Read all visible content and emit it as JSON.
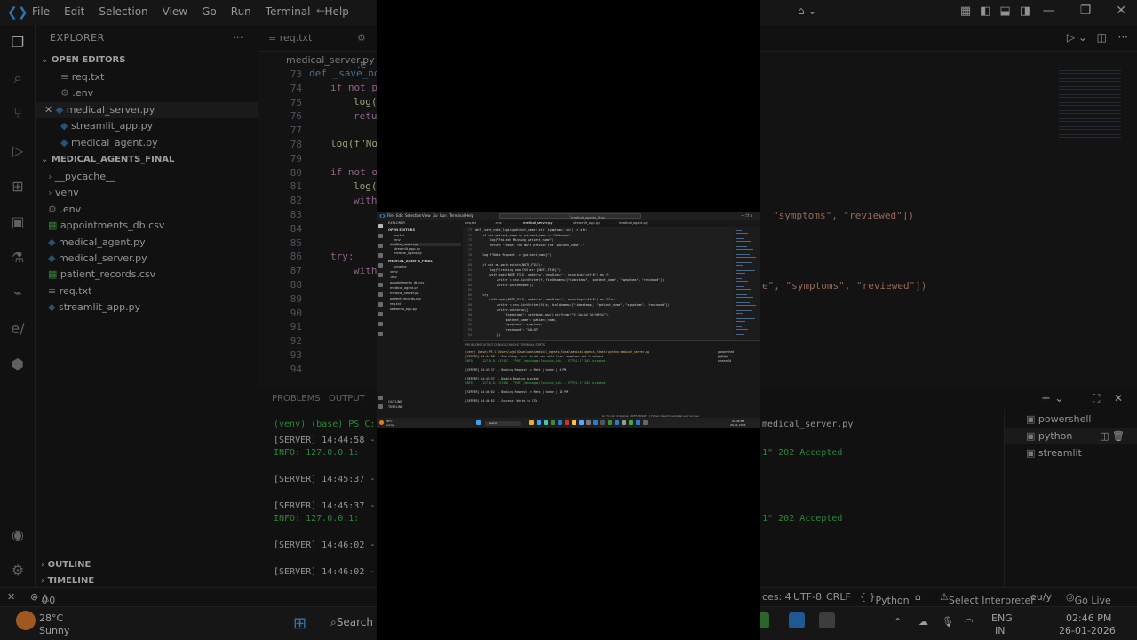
{
  "app": {
    "menu": [
      "File",
      "Edit",
      "Selection",
      "View",
      "Go",
      "Run",
      "Terminal",
      "Help"
    ],
    "window_controls": [
      "—",
      "❐",
      "✕"
    ]
  },
  "explorer": {
    "title": "EXPLORER",
    "open_editors_label": "OPEN EDITORS",
    "open_editors": [
      "req.txt",
      ".env",
      "medical_server.py",
      "streamlit_app.py",
      "medical_agent.py"
    ],
    "project_label": "MEDICAL_AGENTS_FINAL",
    "files": [
      "__pycache__",
      "venv",
      ".env",
      "appointments_db.csv",
      "medical_agent.py",
      "medical_server.py",
      "patient_records.csv",
      "req.txt",
      "streamlit_app.py"
    ],
    "outline_label": "OUTLINE",
    "timeline_label": "TIMELINE"
  },
  "editor": {
    "tabs": [
      "req.txt",
      ".e"
    ],
    "breadcrumb": "medical_server.py",
    "line_numbers": [
      "73",
      "74",
      "75",
      "76",
      "77",
      "78",
      "79",
      "80",
      "81",
      "82",
      "83",
      "84",
      "85",
      "86",
      "87",
      "88",
      "89",
      "90",
      "91",
      "92",
      "93",
      "94"
    ],
    "visible_fragments": {
      "l73": "def _save_no",
      "l74": "if not p",
      "l75": "log(",
      "l76": "retu",
      "l78": "log(f\"No",
      "l80": "if not o",
      "l81": "log(",
      "l82": "with",
      "l86": "try:",
      "l87": "with"
    },
    "right_fragment_1": "\"symptoms\", \"reviewed\"])",
    "right_fragment_2": "e\", \"symptoms\", \"reviewed\"])"
  },
  "panel": {
    "tabs": [
      "PROBLEMS",
      "OUTPUT"
    ],
    "terminal_lines": [
      "(venv) (base) PS C:",
      "[SERVER] 14:44:58 -",
      "INFO:     127.0.0.1:",
      "[SERVER] 14:45:37 -",
      "[SERVER] 14:45:37 -",
      "INFO:     127.0.0.1:",
      "[SERVER] 14:46:02 -",
      "[SERVER] 14:46:02 -"
    ],
    "terminal_right_1": "medical_server.py",
    "terminal_right_2": "TP/1.1\" 202 Accepted",
    "terminal_right_3": "TP/1.1\" 202 Accepted",
    "terminal_instances": [
      "powershell",
      "python",
      "streamlit"
    ]
  },
  "statusbar": {
    "errors": "0",
    "warnings": "0",
    "spaces": "ces: 4",
    "encoding": "UTF-8",
    "eol": "CRLF",
    "language": "Python",
    "interpreter": "Select Interpreter",
    "eslint": "eu/y",
    "golive": "Go Live"
  },
  "taskbar": {
    "weather_temp": "28°C",
    "weather_desc": "Sunny",
    "search": "Search",
    "lang": "ENG",
    "region": "IN",
    "time": "02:46 PM",
    "date": "26-01-2026"
  },
  "mini": {
    "search_text": "medical_agents_final",
    "tabs": [
      "req.txt",
      ".env",
      "medical_server.py",
      "streamlit_app.py",
      "medical_agent.py"
    ],
    "code_lines": [
      {
        "n": "73",
        "t": "def _save_note_logic(patient_name: str, symptoms: str) -> str:"
      },
      {
        "n": "74",
        "t": "    if not patient_name or patient_name == \"Unknown\":"
      },
      {
        "n": "75",
        "t": "        log(\"Failed: Missing patient_name\")"
      },
      {
        "n": "76",
        "t": "        return \"ERROR: You must provide the 'patient_name'.\""
      },
      {
        "n": "77",
        "t": ""
      },
      {
        "n": "78",
        "t": "    log(f\"Note Request -> {patient_name}\")"
      },
      {
        "n": "79",
        "t": ""
      },
      {
        "n": "80",
        "t": "    if not os.path.exists(NOTE_FILE):"
      },
      {
        "n": "81",
        "t": "        log(\"Creating new CSV at: {NOTE_FILE}\")"
      },
      {
        "n": "82",
        "t": "        with open(NOTE_FILE, mode='w', newline='', encoding='utf-8') as f:"
      },
      {
        "n": "83",
        "t": "            writer = csv.DictWriter(f, fieldnames=[\"timestamp\", \"patient_name\", \"symptoms\", \"reviewed\"])"
      },
      {
        "n": "84",
        "t": "            writer.writeheader()"
      },
      {
        "n": "85",
        "t": ""
      },
      {
        "n": "86",
        "t": "    try:"
      },
      {
        "n": "87",
        "t": "        with open(NOTE_FILE, mode='a', newline='', encoding='utf-8') as file:"
      },
      {
        "n": "88",
        "t": "            writer = csv.DictWriter(file, fieldnames=[\"timestamp\", \"patient_name\", \"symptoms\", \"reviewed\"])"
      },
      {
        "n": "89",
        "t": "            writer.writerow({"
      },
      {
        "n": "90",
        "t": "                \"timestamp\": datetime.now().strftime(\"%Y-%m-%d %H:%M:%S\"),"
      },
      {
        "n": "91",
        "t": "                \"patient_name\": patient_name,"
      },
      {
        "n": "92",
        "t": "                \"symptoms\": symptoms,"
      },
      {
        "n": "93",
        "t": "                \"reviewed\": \"FALSE\""
      },
      {
        "n": "94",
        "t": "            })"
      }
    ],
    "panel_tabs": "PROBLEMS   OUTPUT   DEBUG CONSOLE   TERMINAL   PORTS",
    "term_lines": [
      "(venv) (base) PS C:\\Users\\ujal\\Downloads\\medical_agents_final\\medical_agents_final> python medical_server.py",
      "[SERVER] 14:44:58 -- Searching: sore throat and mild fever symptoms and treatment",
      "INFO:     127.0.0.1:57481 - \"POST /messages/?session_id=... HTTP/1.1\" 202 Accepted",
      "",
      "[SERVER] 14:45:37 -- Booking Request -> Mark | today | 4 PM",
      "",
      "[SERVER] 14:45:37 -- Double Booking blocked",
      "INFO:     127.0.0.1:57490 - \"POST /messages/?session_id=... HTTP/1.1\" 202 Accepted",
      "",
      "[SERVER] 14:46:02 -- Booking Request -> Mark | today | 10 PM",
      "",
      "[SERVER] 14:46:02 -- Success: Wrote to CSV"
    ],
    "term_instances": [
      "powershell",
      "python",
      "streamlit"
    ],
    "status": "Ln 73, Col 16   Spaces: 4   UTF-8   CRLF   {} Python   Select Interpreter   eu/y   Go Live",
    "task_weather": "28°C",
    "task_weather2": "Sunny",
    "task_search": "Search",
    "task_time": "02:46 PM",
    "task_date": "26-01-2026"
  }
}
